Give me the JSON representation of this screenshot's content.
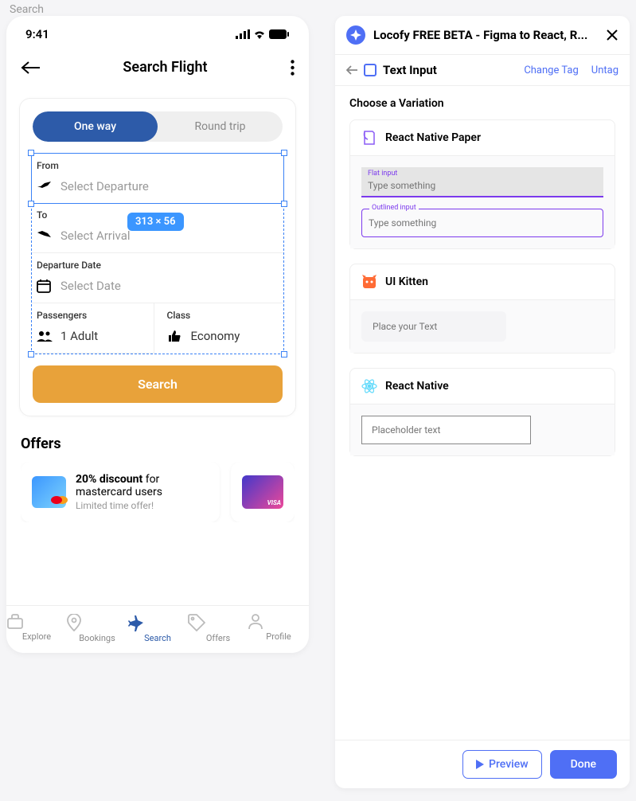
{
  "top_search": "Search",
  "phone": {
    "time": "9:41",
    "header_title": "Search Flight",
    "trip": {
      "one_way": "One way",
      "round_trip": "Round trip"
    },
    "selection_size": "313 × 56",
    "fields": {
      "from_label": "From",
      "from_placeholder": "Select Departure",
      "to_label": "To",
      "to_placeholder": "Select Arrival",
      "date_label": "Departure Date",
      "date_placeholder": "Select Date",
      "passengers_label": "Passengers",
      "passengers_value": "1 Adult",
      "class_label": "Class",
      "class_value": "Economy"
    },
    "search_btn": "Search",
    "offers_title": "Offers",
    "offers": [
      {
        "title_bold": "20% discount",
        "title_rest": " for mastercard users",
        "subtitle": "Limited time offer!"
      },
      {
        "visa_label": "VISA"
      }
    ],
    "nav": [
      {
        "label": "Explore"
      },
      {
        "label": "Bookings"
      },
      {
        "label": "Search"
      },
      {
        "label": "Offers"
      },
      {
        "label": "Profile"
      }
    ]
  },
  "panel": {
    "title": "Locofy FREE BETA - Figma to React, R...",
    "tag": "Text Input",
    "change_tag": "Change Tag",
    "untag": "Untag",
    "choose": "Choose a Variation",
    "variations": {
      "paper": {
        "name": "React Native Paper",
        "flat_label": "Flat input",
        "flat_placeholder": "Type something",
        "outlined_label": "Outlined input",
        "outlined_placeholder": "Type something"
      },
      "kitten": {
        "name": "UI Kitten",
        "placeholder": "Place your Text"
      },
      "rn": {
        "name": "React Native",
        "placeholder": "Placeholder text"
      }
    },
    "preview": "Preview",
    "done": "Done"
  }
}
